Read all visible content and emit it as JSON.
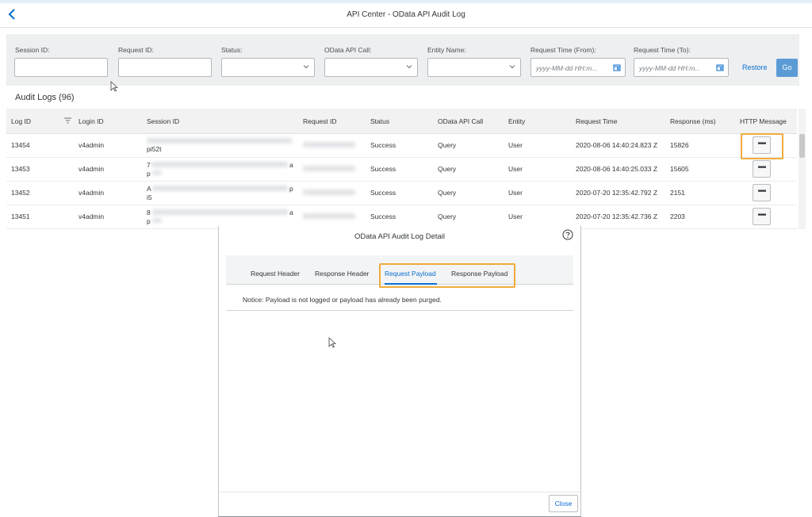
{
  "header": {
    "title": "API Center - OData API Audit Log"
  },
  "filters": {
    "session_id_label": "Session ID:",
    "request_id_label": "Request ID:",
    "status_label": "Status:",
    "odata_call_label": "OData API Call:",
    "entity_label": "Entity Name:",
    "time_from_label": "Request Time (From):",
    "time_to_label": "Request Time (To):",
    "time_from_placeholder": "yyyy-MM-dd HH:m...",
    "time_to_placeholder": "yyyy-MM-dd HH:m...",
    "restore_label": "Restore",
    "go_label": "Go"
  },
  "table": {
    "title": "Audit Logs (96)",
    "columns": [
      "Log ID",
      "Login ID",
      "Session ID",
      "Request ID",
      "Status",
      "OData API Call",
      "Entity",
      "Request Time",
      "Response (ms)",
      "HTTP Message"
    ],
    "rows": [
      {
        "log_id": "13454",
        "login_id": "v4admin",
        "session_suffix": "pi52t",
        "status": "Success",
        "call": "Query",
        "entity": "User",
        "time": "2020-08-06 14:40:24.823 Z",
        "response": "15826"
      },
      {
        "log_id": "13453",
        "login_id": "v4admin",
        "session_prefix": "7",
        "session_char": "a",
        "session_line2": "p",
        "status": "Success",
        "call": "Query",
        "entity": "User",
        "time": "2020-08-06 14:40:25.033 Z",
        "response": "15605"
      },
      {
        "log_id": "13452",
        "login_id": "v4admin",
        "session_prefix": "A",
        "session_char": "p",
        "session_line2": "i5",
        "status": "Success",
        "call": "Query",
        "entity": "User",
        "time": "2020-07-20 12:35:42.792 Z",
        "response": "2151"
      },
      {
        "log_id": "13451",
        "login_id": "v4admin",
        "session_prefix": "8",
        "session_char": "a",
        "session_line2": "p",
        "status": "Success",
        "call": "Query",
        "entity": "User",
        "time": "2020-07-20 12:35:42.736 Z",
        "response": "2203"
      }
    ],
    "more_label": "••••"
  },
  "dialog": {
    "title": "OData API Audit Log Detail",
    "tabs": [
      "Request Header",
      "Response Header",
      "Request Payload",
      "Response Payload"
    ],
    "active_tab": "Request Payload",
    "notice": "Notice: Payload is not logged or payload has already been purged.",
    "close_label": "Close"
  },
  "colors": {
    "accent": "#0a6ed1",
    "highlight": "#f0ab3c",
    "go_button": "#5b9bd5"
  }
}
